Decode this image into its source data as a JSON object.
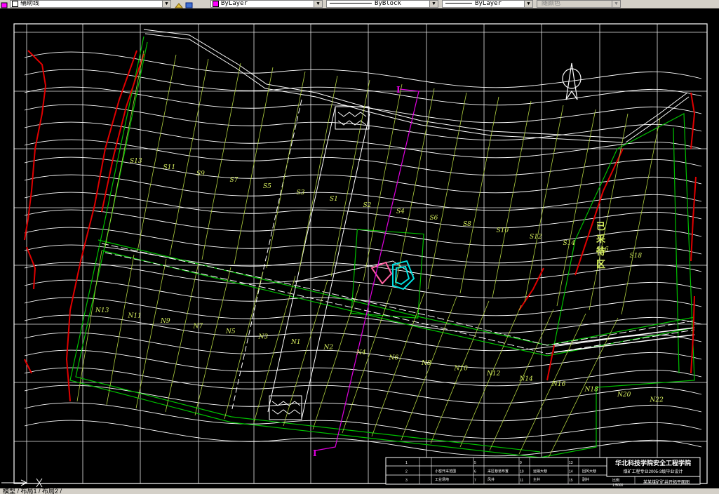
{
  "toolbar": {
    "layer_name": "辅助线",
    "color_value": "ByLayer",
    "linetype_value": "ByBlock",
    "lineweight_value": "ByLayer",
    "plotstyle_value": "随颜色"
  },
  "tabs": {
    "text": "模型 / 布局1 / 布局2 /"
  },
  "drawing": {
    "section_label_top": "I",
    "section_label_bottom": "I",
    "mining_zone_text": [
      "已",
      "采",
      "待",
      "区"
    ],
    "s_panels": [
      "S13",
      "S11",
      "S9",
      "S7",
      "S5",
      "S3",
      "S1",
      "S2",
      "S4",
      "S6",
      "S8",
      "S10",
      "S12",
      "S14",
      "S16",
      "S18"
    ],
    "n_panels": [
      "N13",
      "N11",
      "N9",
      "N7",
      "N5",
      "N3",
      "N1",
      "N2",
      "N4",
      "N6",
      "N8",
      "N10",
      "N12",
      "N14",
      "N16",
      "N18",
      "N20",
      "N22"
    ]
  },
  "title_block": {
    "school": "华北科技学院安全工程学院",
    "subtitle": "煤矿工程专业2005-3级毕业设计",
    "drawing_title": "某某煤矿矿井开拓平面图",
    "scale_label": "比例",
    "scale_value": "1:5000",
    "designer_label": "设计人",
    "date_label": "完成日期",
    "row_numbers": [
      "1",
      "2",
      "3",
      "4",
      "5",
      "6",
      "7",
      "8",
      "9",
      "10",
      "11",
      "12",
      "13",
      "14",
      "15",
      "16"
    ],
    "legend_entries": [
      "小窑开采范围",
      "采区巷道布置",
      "运输大巷",
      "回风大巷",
      "工业场地",
      "风井",
      "主井",
      "副井"
    ]
  }
}
